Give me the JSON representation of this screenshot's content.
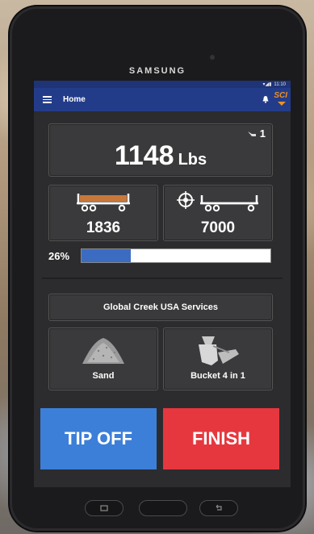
{
  "device": {
    "brand": "SAMSUNG"
  },
  "status_bar": {
    "time": "11:10"
  },
  "app_bar": {
    "title": "Home",
    "logo": "SCI"
  },
  "weight": {
    "value": "1148",
    "unit": "Lbs",
    "load_count": "1"
  },
  "trucks": {
    "current": "1836",
    "target": "7000"
  },
  "progress": {
    "label": "26%",
    "fraction": 0.26
  },
  "company": "Global Creek USA Services",
  "materials": {
    "left_label": "Sand",
    "right_label": "Bucket 4 in 1"
  },
  "actions": {
    "tip_off": "TIP OFF",
    "finish": "FINISH"
  },
  "colors": {
    "appbar": "#233c8a",
    "tip_off": "#3c7fd8",
    "finish": "#e6373f",
    "progress": "#3b6cc2",
    "truck_bed": "#c8783a"
  },
  "icons": [
    "menu-icon",
    "bell-icon",
    "bucket-load-icon",
    "truck-loaded-icon",
    "target-icon",
    "truck-empty-icon",
    "sand-pile-icon",
    "bucket-icon",
    "recent-apps-icon",
    "back-icon"
  ]
}
